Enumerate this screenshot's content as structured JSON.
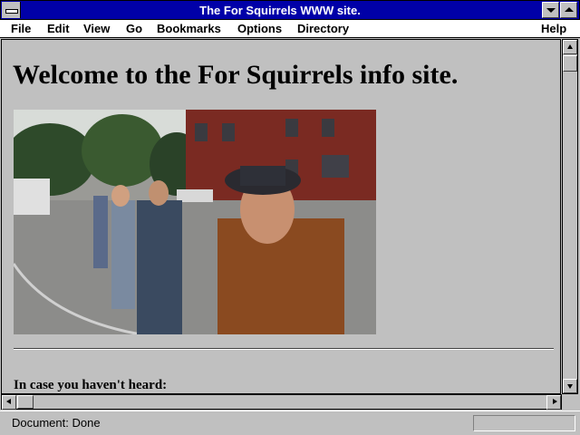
{
  "window": {
    "title": "The For Squirrels WWW site."
  },
  "menu": [
    "File",
    "Edit",
    "View",
    "Go",
    "Bookmarks",
    "Options",
    "Directory",
    "Help"
  ],
  "page": {
    "heading": "Welcome to the For Squirrels info site.",
    "subheading": "In case you haven't heard:"
  },
  "status": {
    "text": "Document: Done"
  }
}
